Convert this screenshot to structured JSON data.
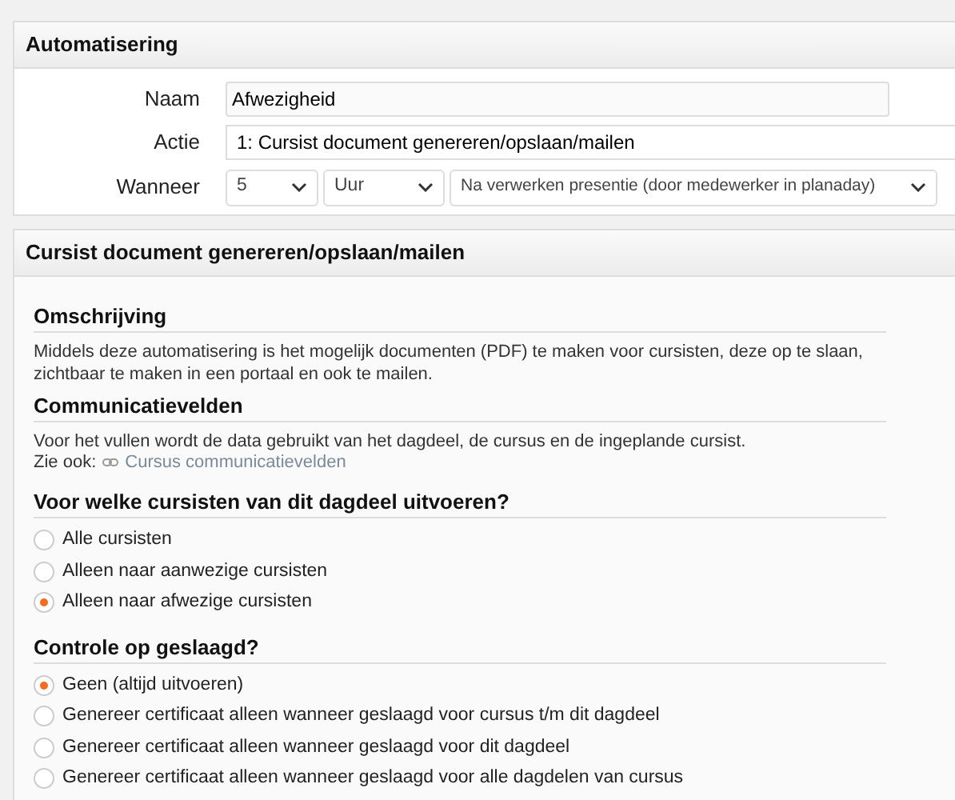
{
  "automation_panel": {
    "title": "Automatisering",
    "fields": [
      {
        "kind": "text",
        "label": "Naam",
        "value": "Afwezigheid"
      },
      {
        "kind": "wide",
        "label": "Actie",
        "value": "1: Cursist document genereren/opslaan/mailen"
      },
      {
        "kind": "selects",
        "label": "Wanneer",
        "selects": [
          "5",
          "Uur",
          "Na verwerken presentie (door medewerker in planaday)"
        ]
      }
    ]
  },
  "action_panel": {
    "title": "Cursist document genereren/opslaan/mailen",
    "sections": [
      {
        "kind": "text",
        "heading": "Omschrijving",
        "lines": [
          "Middels deze automatisering is het mogelijk documenten (PDF) te maken voor cursisten, deze op te slaan,",
          "zichtbaar te maken in een portaal en ook te mailen."
        ]
      },
      {
        "kind": "text",
        "heading": "Communicatievelden",
        "lines": [
          "Voor het vullen wordt de data gebruikt van het dagdeel, de cursus en de ingeplande cursist."
        ],
        "see_also": {
          "label": "Zie ook:",
          "link": "Cursus communicatievelden"
        }
      },
      {
        "kind": "radios",
        "heading": "Voor welke cursisten van dit dagdeel uitvoeren?",
        "options": [
          {
            "label": "Alle cursisten",
            "selected": false
          },
          {
            "label": "Alleen naar aanwezige cursisten",
            "selected": false
          },
          {
            "label": "Alleen naar afwezige cursisten",
            "selected": true
          }
        ]
      },
      {
        "kind": "radios",
        "heading": "Controle op geslaagd?",
        "options": [
          {
            "label": "Geen (altijd uitvoeren)",
            "selected": true
          },
          {
            "label": "Genereer certificaat alleen wanneer geslaagd voor cursus t/m dit dagdeel",
            "selected": false
          },
          {
            "label": "Genereer certificaat alleen wanneer geslaagd voor dit dagdeel",
            "selected": false
          },
          {
            "label": "Genereer certificaat alleen wanneer geslaagd voor alle dagdelen van cursus",
            "selected": false
          }
        ]
      }
    ]
  }
}
